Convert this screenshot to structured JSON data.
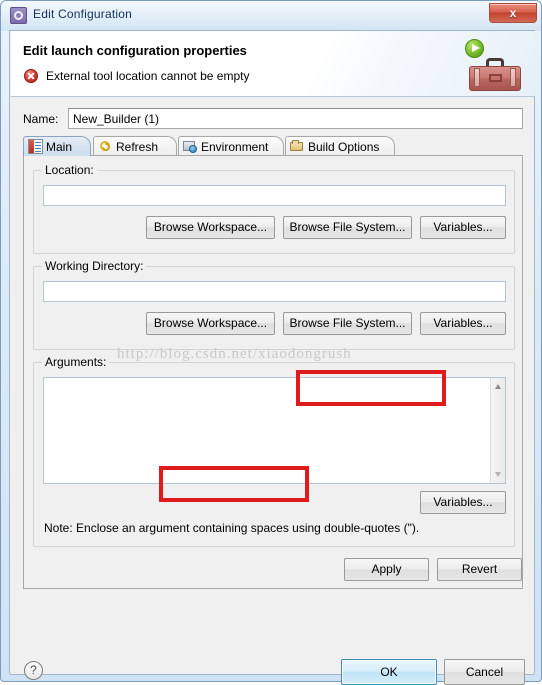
{
  "window": {
    "title": "Edit Configuration",
    "title_icon": "configuration-gear-icon",
    "close_label": "x"
  },
  "header": {
    "title": "Edit launch configuration properties",
    "message": "External tool location cannot be empty",
    "message_icon": "error-icon",
    "art_icons": [
      "run-play-icon",
      "toolbox-icon"
    ]
  },
  "name_field": {
    "label": "Name:",
    "value": "New_Builder (1)",
    "placeholder": ""
  },
  "tabs": [
    {
      "label": "Main",
      "icon": "main-page-icon",
      "active": true
    },
    {
      "label": "Refresh",
      "icon": "refresh-arrows-icon",
      "active": false
    },
    {
      "label": "Environment",
      "icon": "environment-globe-icon",
      "active": false
    },
    {
      "label": "Build Options",
      "icon": "open-folder-icon",
      "active": false
    }
  ],
  "location_group": {
    "legend": "Location:",
    "value": "",
    "buttons": [
      {
        "label": "Browse Workspace...",
        "highlighted": false
      },
      {
        "label": "Browse File System...",
        "highlighted": true
      },
      {
        "label": "Variables...",
        "highlighted": false
      }
    ]
  },
  "working_directory_group": {
    "legend": "Working Directory:",
    "value": "",
    "buttons": [
      {
        "label": "Browse Workspace...",
        "highlighted": true
      },
      {
        "label": "Browse File System...",
        "highlighted": false
      },
      {
        "label": "Variables...",
        "highlighted": false
      }
    ]
  },
  "arguments_group": {
    "legend": "Arguments:",
    "value": "",
    "variables_button": "Variables...",
    "note": "Note: Enclose an argument containing spaces using double-quotes (\")."
  },
  "config_buttons": {
    "apply": "Apply",
    "revert": "Revert"
  },
  "footer": {
    "help_icon": "help-question-icon",
    "help_label": "?",
    "ok": "OK",
    "cancel": "Cancel"
  },
  "watermark": {
    "text": "http://blog.csdn.net/xiaodongrush"
  },
  "colors": {
    "highlight_red": "#e01b1b",
    "error_red": "#c0392b",
    "title_text": "#14305a",
    "default_button_border": "#3c8dbc"
  }
}
